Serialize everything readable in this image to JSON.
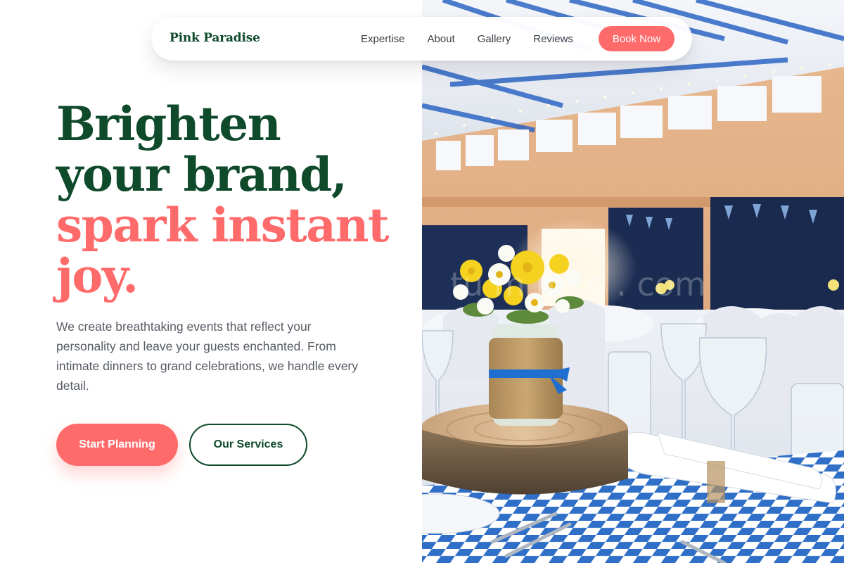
{
  "brand": {
    "name": "Pink Paradise"
  },
  "nav": {
    "links": [
      "Expertise",
      "About",
      "Gallery",
      "Reviews"
    ],
    "cta": "Book Now"
  },
  "hero": {
    "headline_lines": [
      "Brighten",
      "your brand,",
      "spark instant",
      "joy."
    ],
    "description": "We create breathtaking events that reflect your personality and leave your guests enchanted. From intimate dinners to grand celebrations, we handle every detail.",
    "primary_button": "Start Planning",
    "secondary_button": "Our Services",
    "image_watermark": "tu   m   mi   o . com"
  },
  "colors": {
    "brand_green": "#0f4a2b",
    "accent_coral": "#ff6b6b",
    "body_text": "#555a63",
    "nav_text": "#3b3f46"
  },
  "icons": [
    "flower-vase-icon"
  ]
}
